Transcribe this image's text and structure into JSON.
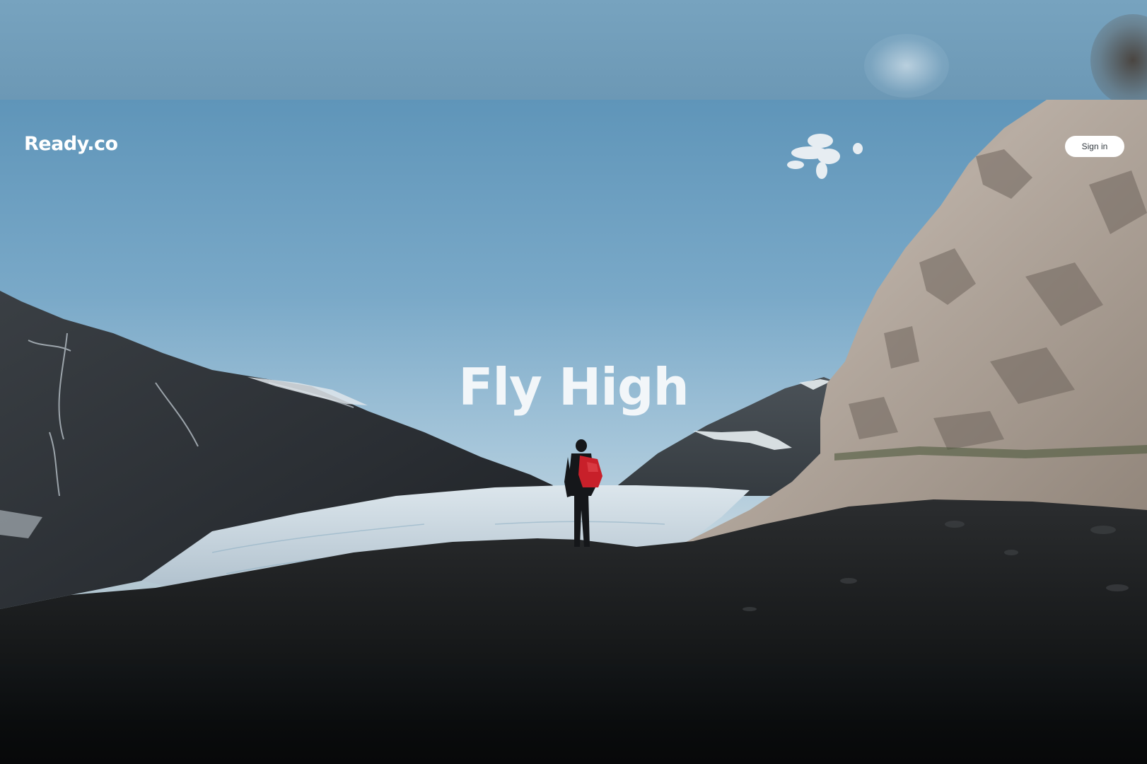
{
  "brand": {
    "logo_text": "Ready.co"
  },
  "header": {
    "sign_in_label": "Sign in"
  },
  "hero": {
    "headline": "Fly High",
    "image_description_icon": "mountain-landscape-image"
  },
  "colors": {
    "sky": "#7aa9c8",
    "headline_text": "#f2f6f9",
    "button_bg": "#ffffff",
    "button_text": "#333a40",
    "backpack": "#c8202a"
  }
}
